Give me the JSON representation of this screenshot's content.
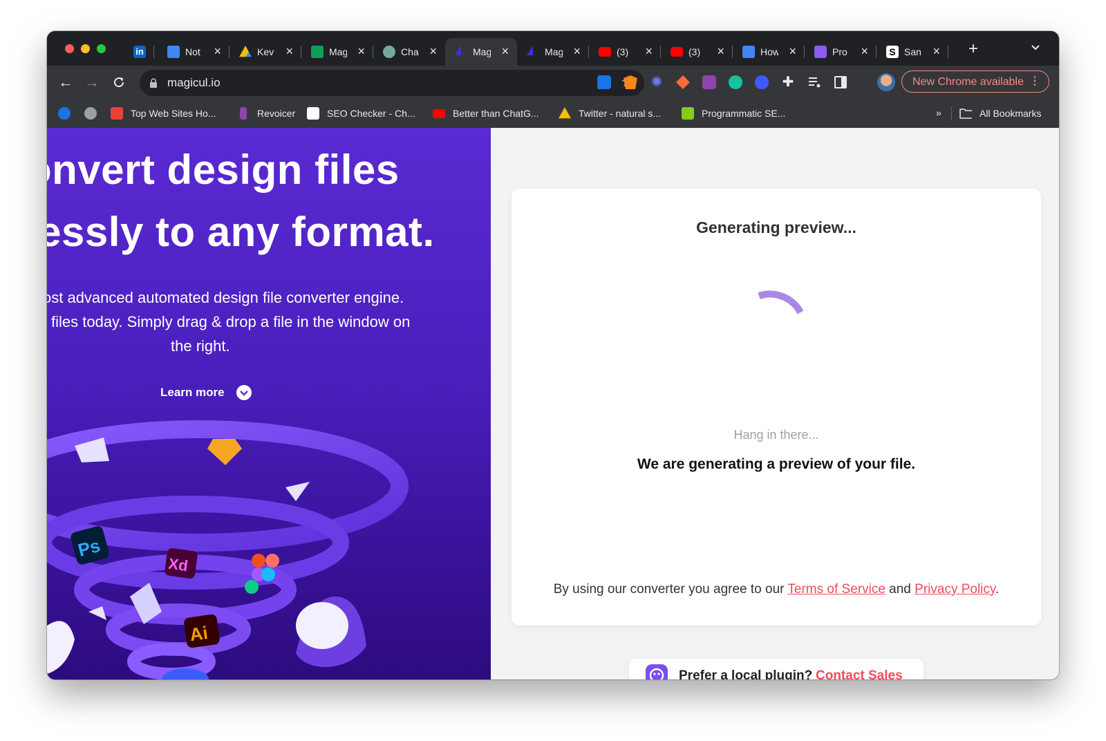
{
  "browser": {
    "tabs": [
      {
        "title": "",
        "favicon": "linkedin-icon",
        "color": "#0a66c2"
      },
      {
        "title": "Not",
        "favicon": "google-docs-icon",
        "color": "#4285f4"
      },
      {
        "title": "Kev",
        "favicon": "google-drive-icon",
        "color": "#fbbc04"
      },
      {
        "title": "Mag",
        "favicon": "google-sheets-icon",
        "color": "#0f9d58"
      },
      {
        "title": "Cha",
        "favicon": "chatgpt-icon",
        "color": "#74aa9c"
      },
      {
        "title": "Mag",
        "favicon": "magicul-icon",
        "color": "#3b2fd6",
        "active": true
      },
      {
        "title": "Mag",
        "favicon": "magicul-icon",
        "color": "#3b2fd6"
      },
      {
        "title": "(3)",
        "favicon": "youtube-icon",
        "color": "#ff0000"
      },
      {
        "title": "(3)",
        "favicon": "youtube-icon",
        "color": "#ff0000"
      },
      {
        "title": "How",
        "favicon": "google-docs-icon",
        "color": "#4285f4"
      },
      {
        "title": "Pro",
        "favicon": "forms-icon",
        "color": "#8c5cf0"
      },
      {
        "title": "San",
        "favicon": "s-logo-icon",
        "color": "#ffffff"
      }
    ],
    "url": "magicul.io",
    "update_button": "New Chrome available",
    "bookmarks": [
      {
        "label": "Top Web Sites Ho...",
        "icon": "bookmark-favicon",
        "color": "#e94235"
      },
      {
        "label": "Revoicer",
        "icon": "revoicer-icon",
        "color": "#8e44ad"
      },
      {
        "label": "SEO Checker - Ch...",
        "icon": "sst-icon",
        "color": "#ffffff"
      },
      {
        "label": "Better than ChatG...",
        "icon": "youtube-icon",
        "color": "#ff0000"
      },
      {
        "label": "Twitter - natural s...",
        "icon": "google-drive-icon",
        "color": "#fbbc04"
      },
      {
        "label": "Programmatic SE...",
        "icon": "code-icon",
        "color": "#84cc16"
      }
    ],
    "bookmarks_overflow": "»",
    "all_bookmarks": "All Bookmarks"
  },
  "hero": {
    "heading_line1": "onvert design files",
    "heading_line2": "lessly to any format.",
    "sub_line1": "ost advanced automated design file converter engine.",
    "sub_line2": "files today. Simply drag & drop a file in the window on",
    "sub_line3": "the right.",
    "learn_more": "Learn more",
    "illustration_labels": {
      "ps": "Ps",
      "xd": "Xd",
      "ai": "Ai"
    }
  },
  "preview": {
    "title": "Generating preview...",
    "hang": "Hang in there...",
    "message": "We are generating a preview of your file.",
    "legal_prefix": "By using our converter you agree to our",
    "terms": "Terms of Service",
    "and": "and",
    "privacy": "Privacy Policy",
    "period": ".",
    "plugin_text": "Prefer a local plugin?",
    "contact": "Contact Sales"
  },
  "colors": {
    "brand_purple": "#5a2ad2",
    "link_red": "#ef4b5b",
    "chrome_dark": "#202124",
    "chrome_toolbar": "#35363a"
  }
}
